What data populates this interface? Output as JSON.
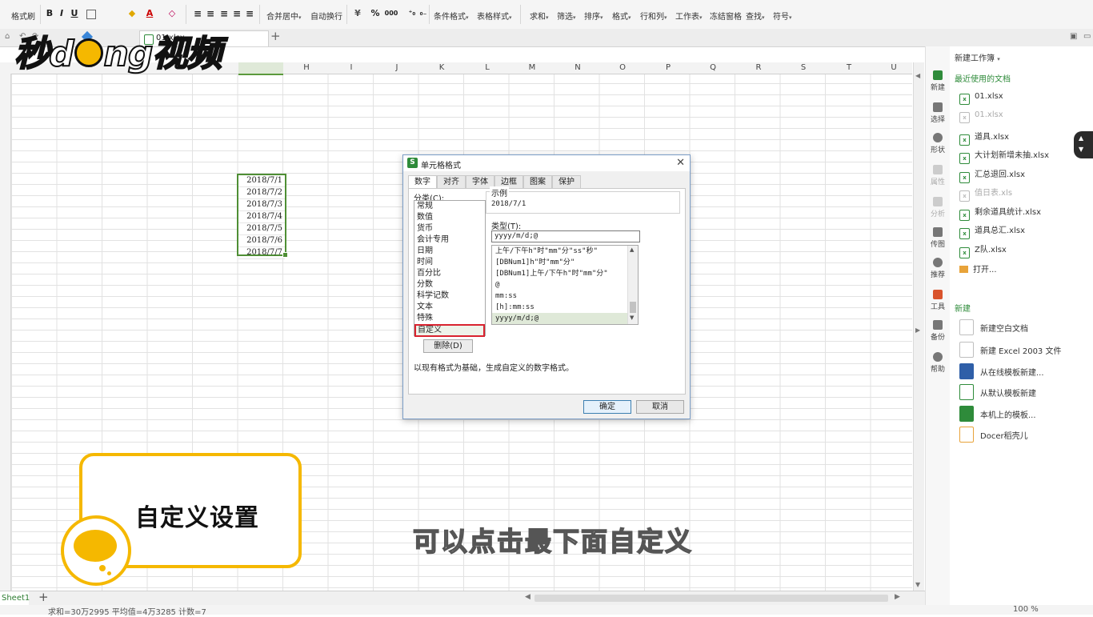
{
  "ribbon": {
    "format_painter": "格式刷",
    "merge_center": "合并居中",
    "wrap_text": "自动换行",
    "cond_format": "条件格式",
    "table_style": "表格样式",
    "sum": "求和",
    "filter": "筛选",
    "sort": "排序",
    "format": "格式",
    "row_col": "行和列",
    "worksheet": "工作表",
    "freeze": "冻结窗格",
    "find": "查找",
    "symbol": "符号",
    "bold": "B",
    "italic": "I",
    "underline": "U",
    "font_color": "A",
    "percent": "%",
    "thousands": "000"
  },
  "tabs": {
    "doc_tab": "01.xlsx"
  },
  "columns": [
    "H",
    "I",
    "J",
    "K",
    "L",
    "M",
    "N",
    "O",
    "P",
    "Q",
    "R",
    "S",
    "T",
    "U"
  ],
  "dates": [
    "2018/7/1",
    "2018/7/2",
    "2018/7/3",
    "2018/7/4",
    "2018/7/5",
    "2018/7/6",
    "2018/7/7"
  ],
  "sheet": {
    "tab": "Sheet1",
    "status": "求和=30万2995  平均值=4万3285  计数=7",
    "zoom": "100 %"
  },
  "sidebar_icons": [
    {
      "label": "新建",
      "dim": false
    },
    {
      "label": "选择",
      "dim": false
    },
    {
      "label": "形状",
      "dim": false
    },
    {
      "label": "属性",
      "dim": true
    },
    {
      "label": "分析",
      "dim": true
    },
    {
      "label": "传图",
      "dim": false
    },
    {
      "label": "推荐",
      "dim": false
    },
    {
      "label": "工具",
      "dim": false
    },
    {
      "label": "备份",
      "dim": false
    },
    {
      "label": "帮助",
      "dim": false
    }
  ],
  "pane": {
    "title": "新建工作簿",
    "recent_title": "最近使用的文档",
    "recent": [
      {
        "name": "01.xlsx",
        "dim": false
      },
      {
        "name": "01.xlsx",
        "dim": true
      },
      {
        "name": "道具.xlsx",
        "dim": false
      },
      {
        "name": "大计划新增未抽.xlsx",
        "dim": false
      },
      {
        "name": "汇总退回.xlsx",
        "dim": false
      },
      {
        "name": "值日表.xls",
        "dim": true
      },
      {
        "name": "剩余道具统计.xlsx",
        "dim": false
      },
      {
        "name": "道具总汇.xlsx",
        "dim": false
      },
      {
        "name": "Z队.xlsx",
        "dim": false
      }
    ],
    "open": "打开...",
    "new_title": "新建",
    "new_items": [
      "新建空白文档",
      "新建 Excel 2003 文件",
      "从在线模板新建...",
      "从默认模板新建",
      "本机上的模板...",
      "Docer稻壳儿"
    ]
  },
  "dialog": {
    "title": "单元格格式",
    "tabs": [
      "数字",
      "对齐",
      "字体",
      "边框",
      "图案",
      "保护"
    ],
    "category_label": "分类(C):",
    "categories": [
      "常规",
      "数值",
      "货币",
      "会计专用",
      "日期",
      "时间",
      "百分比",
      "分数",
      "科学记数",
      "文本",
      "特殊",
      "自定义"
    ],
    "delete_btn": "删除(D)",
    "sample_label": "示例",
    "sample_value": "2018/7/1",
    "type_label": "类型(T):",
    "type_value": "yyyy/m/d;@",
    "type_items": [
      "上午/下午h\"时\"mm\"分\"ss\"秒\"",
      "[DBNum1]h\"时\"mm\"分\"",
      "[DBNum1]上午/下午h\"时\"mm\"分\"",
      "@",
      "mm:ss",
      "[h]:mm:ss",
      "yyyy/m/d;@"
    ],
    "description": "以现有格式为基础，生成自定义的数字格式。",
    "ok": "确定",
    "cancel": "取消"
  },
  "overlay": {
    "logo_a": "秒d",
    "logo_b": "ng视频",
    "callout": "自定义设置",
    "subtitle": "可以点击最下面自定义"
  },
  "colors": {
    "accent_green": "#2e8b3a",
    "selection_green": "#4f8f35",
    "highlight_red": "#d9232f",
    "overlay_yellow": "#f5b800"
  }
}
